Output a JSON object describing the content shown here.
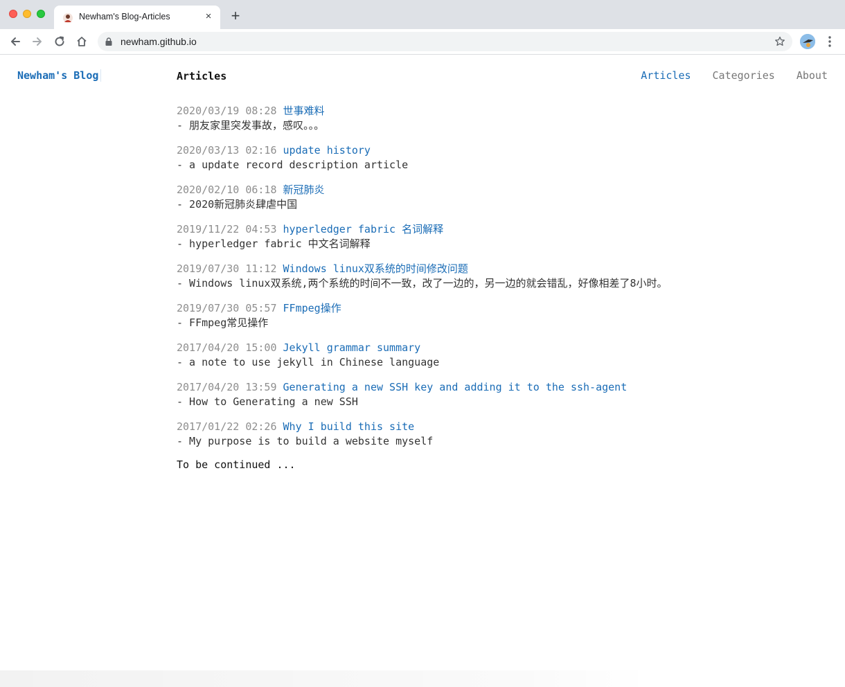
{
  "browser": {
    "tab_title": "Newham's Blog-Articles",
    "tab_close_glyph": "×",
    "new_tab_glyph": "+",
    "url": "newham.github.io",
    "icons": [
      "back-icon",
      "forward-icon",
      "reload-icon",
      "home-icon",
      "lock-icon",
      "star-icon",
      "profile-icon",
      "menu-icon"
    ]
  },
  "site": {
    "brand": "Newham's Blog",
    "heading": "Articles",
    "nav": [
      {
        "label": "Articles",
        "active": true
      },
      {
        "label": "Categories",
        "active": false
      },
      {
        "label": "About",
        "active": false
      }
    ],
    "accent_color": "#1a6cb6"
  },
  "posts": [
    {
      "date": "2020/03/19 08:28",
      "title": "世事难料",
      "desc": "- 朋友家里突发事故，感叹。。。"
    },
    {
      "date": "2020/03/13 02:16",
      "title": "update history",
      "desc": "- a update record description article"
    },
    {
      "date": "2020/02/10 06:18",
      "title": "新冠肺炎",
      "desc": "- 2020新冠肺炎肆虐中国"
    },
    {
      "date": "2019/11/22 04:53",
      "title": "hyperledger fabric 名词解释",
      "desc": "- hyperledger fabric 中文名词解释"
    },
    {
      "date": "2019/07/30 11:12",
      "title": "Windows linux双系统的时间修改问题",
      "desc": "- Windows linux双系统,两个系统的时间不一致，改了一边的，另一边的就会错乱，好像相差了8小时。"
    },
    {
      "date": "2019/07/30 05:57",
      "title": "FFmpeg操作",
      "desc": "- FFmpeg常见操作"
    },
    {
      "date": "2017/04/20 15:00",
      "title": "Jekyll grammar summary",
      "desc": "- a note to use jekyll in Chinese language"
    },
    {
      "date": "2017/04/20 13:59",
      "title": "Generating a new SSH key and adding it to the ssh-agent",
      "desc": "- How to Generating a new SSH"
    },
    {
      "date": "2017/01/22 02:26",
      "title": "Why I build this site",
      "desc": "- My purpose is to build a website myself"
    }
  ],
  "footer": {
    "continued": "To be continued ..."
  }
}
